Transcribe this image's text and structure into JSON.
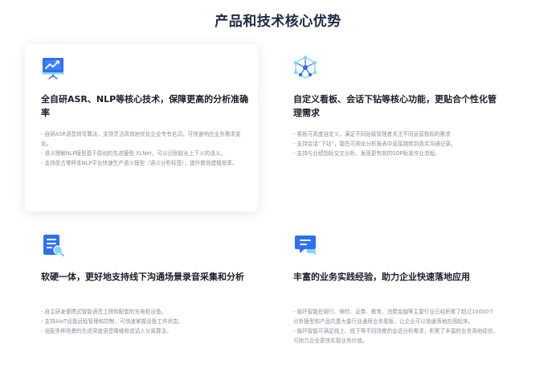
{
  "page": {
    "title": "产品和技术核心优势"
  },
  "cards": [
    {
      "icon": "presentation-chart-icon",
      "title": "全自研ASR、NLP等核心技术，保障更高的分析准确率",
      "items": [
        "- 自研ASR语音转写算法，支持灵活高效地优化企业专有名词，可快速响应业务需求变化。",
        "- 语义理解NLP模型基于原创的先进模型 XLNet，可以识别超长上下义的语义。",
        "- 支持盘古零样本NLP平台快速生产语义模型（语义分析标签），提升数倍建模效率。"
      ]
    },
    {
      "icon": "network-nodes-icon",
      "title": "自定义看板、会话下钻等核心功能，更贴合个性化管理需求",
      "items": [
        "- 看板可高度自定义，满足不同层级管理者关注不同运营指标的需求",
        "- 支持会话“下钻”，能在可视化分析报表中直接跳转到真实沟通记录。",
        "- 支持与业绩指标交叉分析，发现更有效的SOP标准作业流程。"
      ]
    },
    {
      "icon": "document-search-icon",
      "title": "软硬一体，更好地支持线下沟通场景录音采集和分析",
      "items": [
        "- 自主研发便携式智能语音工牌和配套的充电柜设备。",
        "- 支持AIoT设备远程管理和控制，可快速掌握设备工作状态。",
        "- 适配多种场景的先进深度语音降噪和说话人分离算法。"
      ]
    },
    {
      "icon": "chat-bubbles-icon",
      "title": "丰富的业务实践经验，助力企业快速落地应用",
      "items": [
        "- 循环智能在银行、保险、证券、教育、消费金融等主要行业已经积累了超过10000个分析模型和产品内置大量行业通用业务看板，让企业可以快速落地应用起来。",
        "- 循环智能可满足线上、线下等不同场景的会话分析需求，积累了丰富的业务落地经验，可助力企业更快实现业务价值。"
      ]
    }
  ],
  "colors": {
    "title": "#1e2a44",
    "accent_blue": "#2f6ff6",
    "accent_light": "#7fd6f5",
    "body_text": "#8a8f99"
  }
}
